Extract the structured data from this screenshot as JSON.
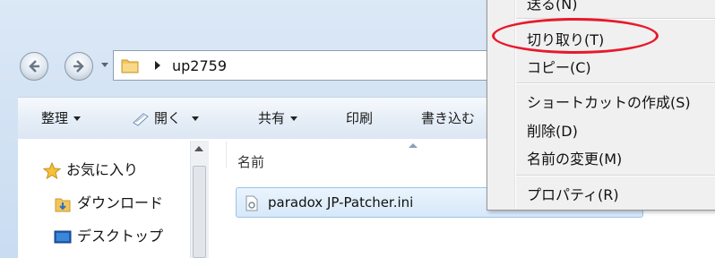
{
  "address_bar": {
    "breadcrumb": "up2759"
  },
  "toolbar": {
    "organize": "整理",
    "open": "開く",
    "share": "共有",
    "print": "印刷",
    "burn": "書き込む"
  },
  "nav_pane": {
    "items": [
      {
        "label": "お気に入り",
        "icon": "star-icon"
      },
      {
        "label": "ダウンロード",
        "icon": "download-folder-icon"
      },
      {
        "label": "デスクトップ",
        "icon": "desktop-icon"
      }
    ]
  },
  "file_list": {
    "column_name": "名前",
    "files": [
      {
        "name": "paradox JP-Patcher.ini",
        "icon": "ini-file-icon"
      }
    ]
  },
  "context_menu": {
    "items": [
      {
        "label": "送る(N)"
      },
      {
        "label": "切り取り(T)",
        "circled": true
      },
      {
        "label": "コピー(C)"
      },
      {
        "label": "ショートカットの作成(S)"
      },
      {
        "label": "削除(D)"
      },
      {
        "label": "名前の変更(M)"
      },
      {
        "label": "プロパティ(R)"
      }
    ]
  },
  "colors": {
    "highlight_ring": "#e8192c",
    "selection": "#d7e8f9"
  }
}
